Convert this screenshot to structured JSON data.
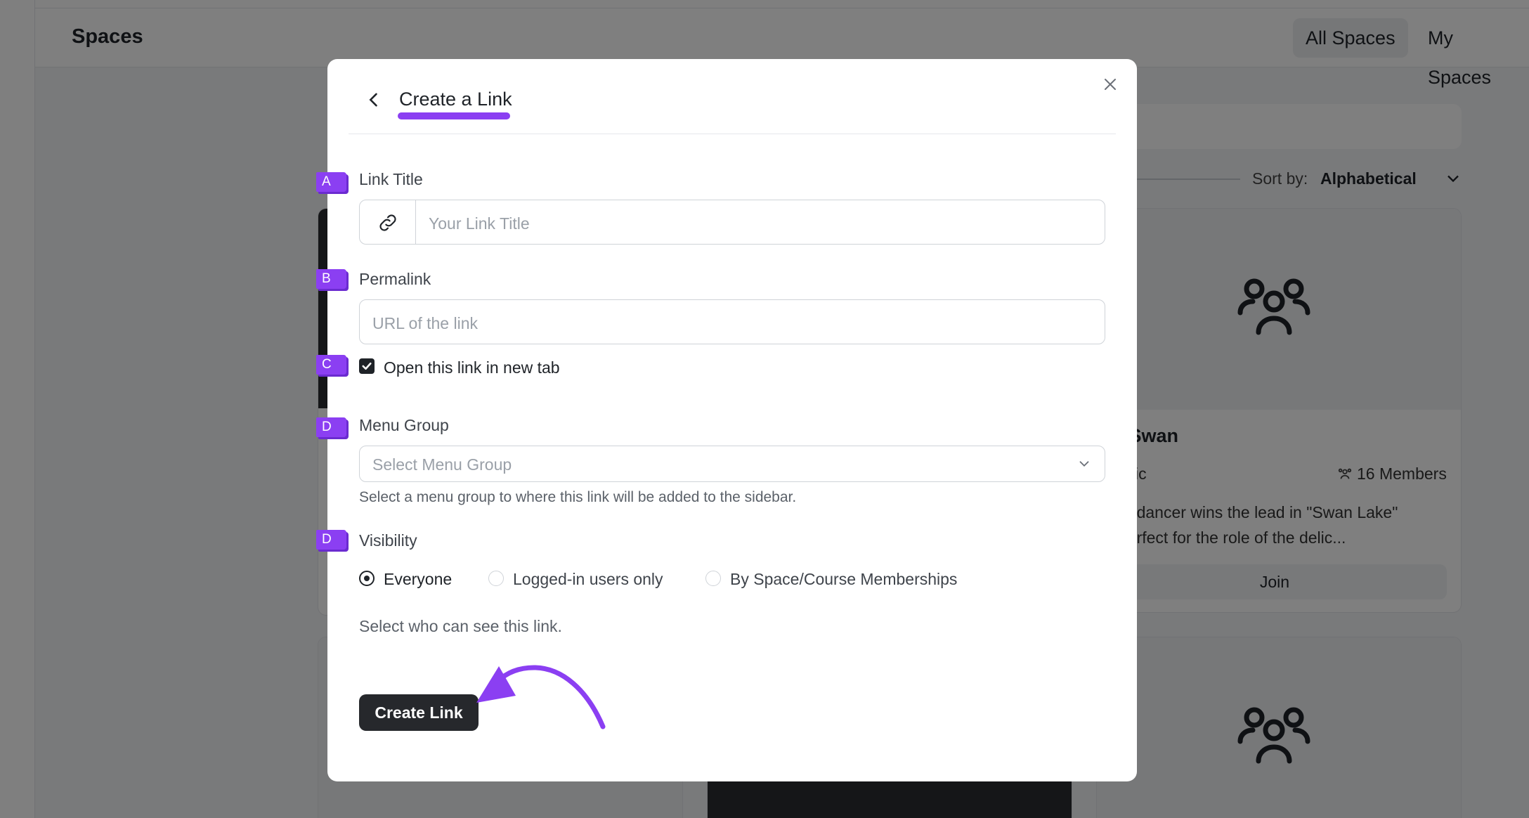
{
  "app": {
    "page_title": "Spaces",
    "tabs": [
      {
        "label": "All Spaces",
        "active": true
      },
      {
        "label": "My Spaces",
        "active": false
      }
    ],
    "sort": {
      "label": "Sort by:",
      "value": "Alphabetical"
    },
    "cards": [
      {
        "title": "ck Swan",
        "privacy": "Public",
        "members": "16 Members",
        "description_line1": "allet dancer wins the lead in \"Swan Lake\"",
        "description_line2": "is perfect for the role of the delic...",
        "join_label": "Join"
      }
    ]
  },
  "modal": {
    "title": "Create a Link",
    "accent_color": "#8b3ff2",
    "fields": {
      "link_title": {
        "label": "Link Title",
        "placeholder": "Your Link Title",
        "icon": "link-icon"
      },
      "permalink": {
        "label": "Permalink",
        "placeholder": "URL of the link"
      },
      "new_tab": {
        "label": "Open this link in new tab",
        "checked": true
      },
      "menu_group": {
        "label": "Menu Group",
        "placeholder": "Select Menu Group",
        "help": "Select a menu group to where this link will be added to the sidebar."
      },
      "visibility": {
        "label": "Visibility",
        "options": [
          {
            "label": "Everyone",
            "selected": true
          },
          {
            "label": "Logged-in users only",
            "selected": false
          },
          {
            "label": "By Space/Course Memberships",
            "selected": false
          }
        ],
        "help": "Select who can see this link."
      }
    },
    "submit_label": "Create Link"
  },
  "annotations": {
    "badges": [
      "A",
      "B",
      "C",
      "D",
      "D"
    ]
  }
}
